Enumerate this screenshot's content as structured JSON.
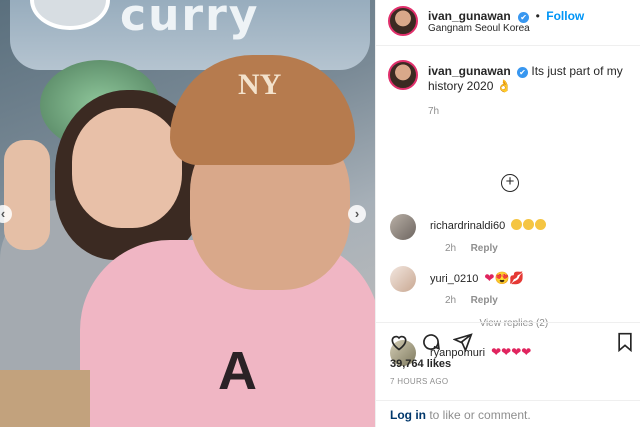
{
  "photo": {
    "sign_text": "curry",
    "cap_logo": "NY",
    "shirt_text": "A",
    "prev_arrow": "‹",
    "next_arrow": "›"
  },
  "post_header": {
    "username": "ivan_gunawan",
    "follow_label": "Follow",
    "separator": "•",
    "location": "Gangnam Seoul Korea",
    "verified_glyph": "✔"
  },
  "caption": {
    "username": "ivan_gunawan",
    "text": "Its just part of my history 2020",
    "emoji": "👌",
    "time": "7h"
  },
  "load_more_glyph": "+",
  "comments": [
    {
      "username": "richardrinaldi60",
      "emoji_count": 3,
      "time": "2h",
      "reply_label": "Reply"
    },
    {
      "username": "yuri_0210",
      "emoji_text": "❤😍💋",
      "time": "2h",
      "reply_label": "Reply",
      "view_replies": "View replies (2)"
    },
    {
      "username": "ryanpomuri",
      "emoji_text": "❤❤❤❤"
    }
  ],
  "actions": {
    "likes": "39,764 likes",
    "posted": "7 HOURS AGO",
    "icons": [
      "heart-icon",
      "comment-icon",
      "share-icon",
      "bookmark-icon"
    ]
  },
  "login": {
    "link_label": "Log in",
    "suffix": " to like or comment."
  },
  "colors": {
    "accent": "#0095f6",
    "heart": "#e0245e",
    "muted": "#8e8e8e"
  }
}
